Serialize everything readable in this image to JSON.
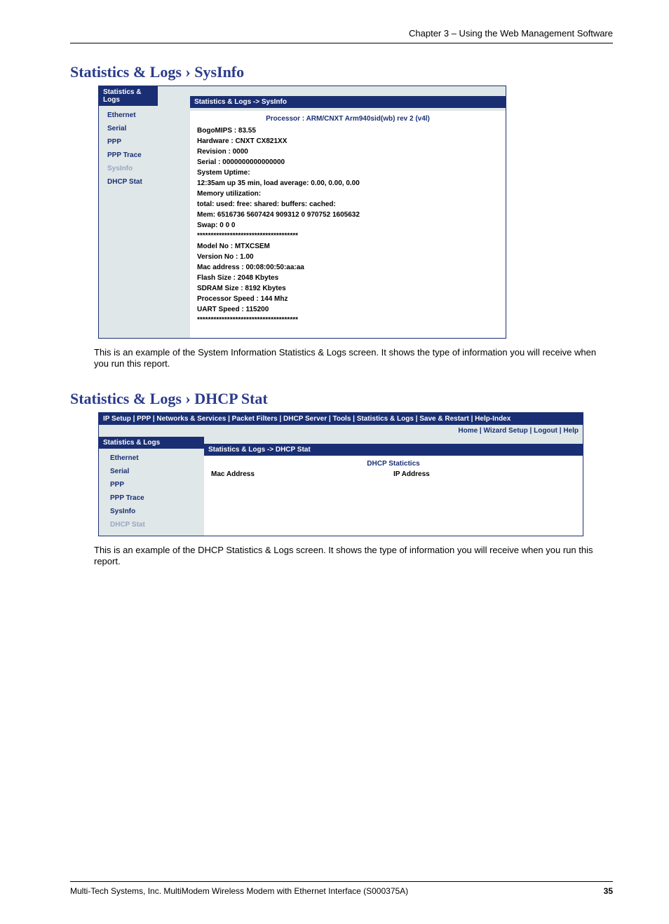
{
  "chapter": "Chapter 3 – Using the Web Management Software",
  "heading1": "Statistics & Logs › SysInfo",
  "heading2": "Statistics & Logs › DHCP Stat",
  "panel1": {
    "tab": "Statistics & Logs",
    "side": [
      "Ethernet",
      "Serial",
      "PPP",
      "PPP Trace",
      "SysInfo",
      "DHCP Stat"
    ],
    "side_muted_index": 4,
    "bar": "Statistics & Logs  ->  SysInfo",
    "processor": "Processor : ARM/CNXT Arm940sid(wb) rev 2 (v4l)",
    "lines": [
      "BogoMIPS : 83.55",
      "Hardware : CNXT CX821XX",
      "Revision : 0000",
      "Serial : 0000000000000000",
      "System Uptime:",
      "12:35am up 35 min, load average: 0.00, 0.00, 0.00",
      "Memory utilization:",
      "total: used: free: shared: buffers: cached:",
      "Mem: 6516736 5607424 909312 0 970752 1605632",
      "Swap: 0 0 0",
      "*************************************",
      "Model No : MTXCSEM",
      "Version No : 1.00",
      "Mac address : 00:08:00:50:aa:aa",
      "Flash Size : 2048 Kbytes",
      "SDRAM Size : 8192 Kbytes",
      "Processor Speed : 144 Mhz",
      "UART Speed : 115200",
      "*************************************"
    ]
  },
  "desc1": "This is an example of the System Information Statistics & Logs screen. It shows the type of information you will receive when you run this report.",
  "panel2": {
    "topnav": "IP Setup |  PPP |  Networks & Services |  Packet Filters |  DHCP Server |  Tools |  Statistics & Logs |  Save & Restart |  Help-Index",
    "subnav": "Home | Wizard Setup | Logout | Help",
    "tab": "Statistics & Logs",
    "side": [
      "Ethernet",
      "Serial",
      "PPP",
      "PPP Trace",
      "SysInfo",
      "DHCP Stat"
    ],
    "side_muted_index": 5,
    "bar": "Statistics & Logs  ->  DHCP Stat",
    "title": "DHCP Statictics",
    "col1": "Mac Address",
    "col2": "IP Address"
  },
  "desc2": "This is an example of the DHCP Statistics & Logs screen. It shows the type of information you will receive when you run this report.",
  "footer_left": "Multi-Tech Systems, Inc. MultiModem Wireless Modem with Ethernet Interface (S000375A)",
  "footer_right": "35"
}
